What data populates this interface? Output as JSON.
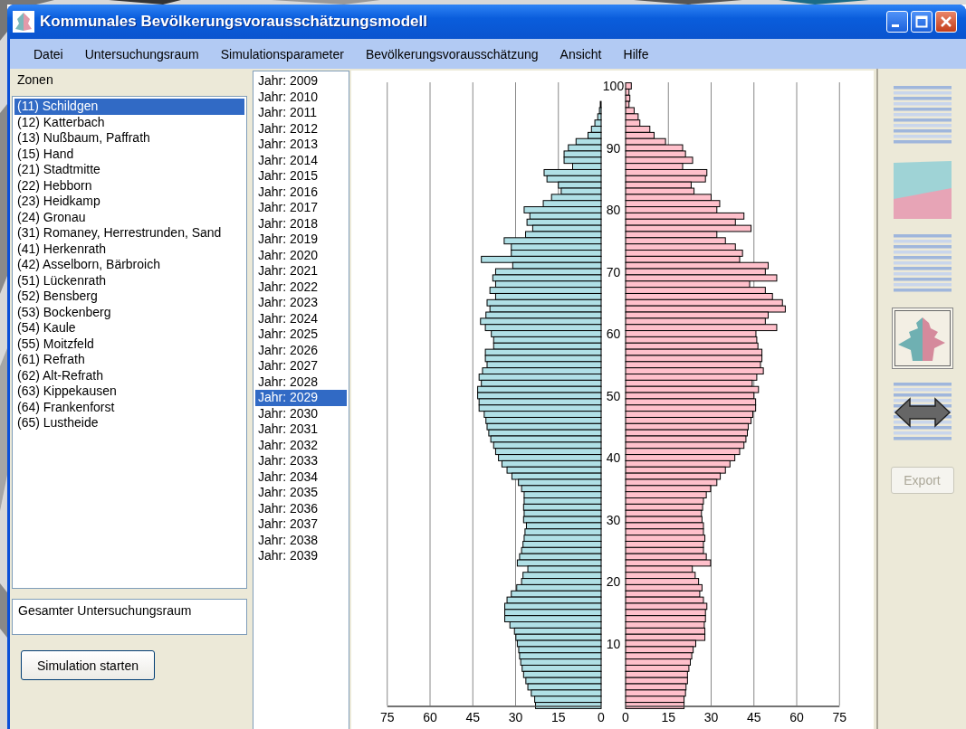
{
  "window": {
    "title": "Kommunales Bevölkerungsvorausschätzungsmodell"
  },
  "menu": [
    "Datei",
    "Untersuchungsraum",
    "Simulationsparameter",
    "Bevölkerungsvorausschätzung",
    "Ansicht",
    "Hilfe"
  ],
  "zones": {
    "label": "Zonen",
    "items": [
      {
        "label": "(11) Schildgen",
        "selected": true
      },
      {
        "label": "(12) Katterbach",
        "selected": false
      },
      {
        "label": "(13) Nußbaum, Paffrath",
        "selected": false
      },
      {
        "label": "(15) Hand",
        "selected": false
      },
      {
        "label": "(21) Stadtmitte",
        "selected": false
      },
      {
        "label": "(22) Hebborn",
        "selected": false
      },
      {
        "label": "(23) Heidkamp",
        "selected": false
      },
      {
        "label": "(24) Gronau",
        "selected": false
      },
      {
        "label": "(31) Romaney, Herrestrunden, Sand",
        "selected": false
      },
      {
        "label": "(41) Herkenrath",
        "selected": false
      },
      {
        "label": "(42) Asselborn, Bärbroich",
        "selected": false
      },
      {
        "label": "(51) Lückenrath",
        "selected": false
      },
      {
        "label": "(52) Bensberg",
        "selected": false
      },
      {
        "label": "(53) Bockenberg",
        "selected": false
      },
      {
        "label": "(54) Kaule",
        "selected": false
      },
      {
        "label": "(55) Moitzfeld",
        "selected": false
      },
      {
        "label": "(61) Refrath",
        "selected": false
      },
      {
        "label": "(62) Alt-Refrath",
        "selected": false
      },
      {
        "label": "(63) Kippekausen",
        "selected": false
      },
      {
        "label": "(64) Frankenforst",
        "selected": false
      },
      {
        "label": "(65) Lustheide",
        "selected": false
      }
    ]
  },
  "region_field": {
    "value": "Gesamter Untersuchungsraum"
  },
  "start_button": "Simulation starten",
  "years": [
    {
      "label": "Jahr: 2009",
      "selected": false
    },
    {
      "label": "Jahr: 2010",
      "selected": false
    },
    {
      "label": "Jahr: 2011",
      "selected": false
    },
    {
      "label": "Jahr: 2012",
      "selected": false
    },
    {
      "label": "Jahr: 2013",
      "selected": false
    },
    {
      "label": "Jahr: 2014",
      "selected": false
    },
    {
      "label": "Jahr: 2015",
      "selected": false
    },
    {
      "label": "Jahr: 2016",
      "selected": false
    },
    {
      "label": "Jahr: 2017",
      "selected": false
    },
    {
      "label": "Jahr: 2018",
      "selected": false
    },
    {
      "label": "Jahr: 2019",
      "selected": false
    },
    {
      "label": "Jahr: 2020",
      "selected": false
    },
    {
      "label": "Jahr: 2021",
      "selected": false
    },
    {
      "label": "Jahr: 2022",
      "selected": false
    },
    {
      "label": "Jahr: 2023",
      "selected": false
    },
    {
      "label": "Jahr: 2024",
      "selected": false
    },
    {
      "label": "Jahr: 2025",
      "selected": false
    },
    {
      "label": "Jahr: 2026",
      "selected": false
    },
    {
      "label": "Jahr: 2027",
      "selected": false
    },
    {
      "label": "Jahr: 2028",
      "selected": false
    },
    {
      "label": "Jahr: 2029",
      "selected": true
    },
    {
      "label": "Jahr: 2030",
      "selected": false
    },
    {
      "label": "Jahr: 2031",
      "selected": false
    },
    {
      "label": "Jahr: 2032",
      "selected": false
    },
    {
      "label": "Jahr: 2033",
      "selected": false
    },
    {
      "label": "Jahr: 2034",
      "selected": false
    },
    {
      "label": "Jahr: 2035",
      "selected": false
    },
    {
      "label": "Jahr: 2036",
      "selected": false
    },
    {
      "label": "Jahr: 2037",
      "selected": false
    },
    {
      "label": "Jahr: 2038",
      "selected": false
    },
    {
      "label": "Jahr: 2039",
      "selected": false
    }
  ],
  "pyramid": {
    "left": {
      "chart_data": {
        "type": "bar",
        "orientation": "horizontal",
        "categories": [
          null,
          null,
          null,
          null,
          null,
          null,
          null,
          null,
          null,
          null,
          null,
          null,
          null,
          null,
          null,
          null,
          null,
          null,
          null,
          null,
          null,
          null,
          null,
          null,
          null,
          null,
          null,
          null,
          null,
          null,
          null,
          null,
          null,
          null,
          null,
          null,
          null,
          null,
          null,
          null,
          null,
          null,
          null,
          null,
          null,
          null,
          null,
          null,
          null,
          null,
          null,
          null,
          null,
          null,
          null,
          null,
          null,
          null,
          null,
          null,
          null,
          null,
          null,
          null,
          null,
          null,
          null,
          null,
          null,
          null,
          null,
          null,
          null,
          null,
          null,
          null,
          null,
          null,
          null,
          null,
          null,
          null,
          null,
          null,
          null,
          null,
          null,
          null,
          null,
          null,
          null,
          null,
          null,
          null,
          null,
          null,
          null,
          null,
          null,
          null,
          null
        ],
        "xticks": [
          75,
          60,
          45,
          30,
          15,
          0
        ],
        "xlim": [
          75,
          0
        ],
        "grid": true,
        "series": [
          {
            "color": "#b0e0e6",
            "values": [
              0,
              0,
              0,
              0.3,
              0.6,
              1.2,
              2.2,
              3.4,
              4.6,
              8.8,
              11.5,
              13,
              13,
              10,
              20,
              19,
              15,
              14,
              17.4,
              20.3,
              27,
              25,
              26,
              24,
              26.5,
              34,
              31.5,
              31.5,
              42,
              31,
              37,
              38,
              37,
              39,
              37,
              40,
              39,
              40.4,
              42.3,
              40.6,
              38.5,
              37.7,
              37.7,
              40.6,
              40.6,
              40,
              41.6,
              42.8,
              42,
              43.3,
              43.3,
              42.8,
              42.8,
              41,
              40.4,
              40,
              39.4,
              38.7,
              37.7,
              37,
              36,
              34.8,
              33,
              31.3,
              29,
              27.9,
              27,
              27,
              27.2,
              27,
              27.2,
              26.2,
              26.7,
              27,
              27.4,
              27.9,
              28.6,
              29.4,
              25.7,
              27.4,
              27.9,
              29.6,
              31.5,
              33,
              33.8,
              33.8,
              33.8,
              32,
              30.4,
              29.9,
              29.4,
              28.9,
              28.6,
              28.2,
              27.7,
              27.2,
              26.4,
              25.7,
              24.5,
              23.3,
              23
            ]
          }
        ]
      }
    },
    "right": {
      "chart_data": {
        "type": "bar",
        "orientation": "horizontal",
        "categories": [
          "100",
          null,
          null,
          null,
          null,
          null,
          null,
          null,
          null,
          null,
          "90",
          null,
          null,
          null,
          null,
          null,
          null,
          null,
          null,
          null,
          "80",
          null,
          null,
          null,
          null,
          null,
          null,
          null,
          null,
          null,
          "70",
          null,
          null,
          null,
          null,
          null,
          null,
          null,
          null,
          null,
          "60",
          null,
          null,
          null,
          null,
          null,
          null,
          null,
          null,
          null,
          "50",
          null,
          null,
          null,
          null,
          null,
          null,
          null,
          null,
          null,
          "40",
          null,
          null,
          null,
          null,
          null,
          null,
          null,
          null,
          null,
          "30",
          null,
          null,
          null,
          null,
          null,
          null,
          null,
          null,
          null,
          "20",
          null,
          null,
          null,
          null,
          null,
          null,
          null,
          null,
          null,
          "10",
          null,
          null,
          null,
          null,
          null,
          null,
          null,
          null,
          null,
          null
        ],
        "xticks": [
          0,
          15,
          30,
          45,
          60,
          75
        ],
        "xlim": [
          0,
          75
        ],
        "grid": true,
        "series": [
          {
            "color": "#ffc0cb",
            "values": [
              2,
              1.2,
              1.5,
              1.2,
              3,
              4.4,
              5,
              8.5,
              10,
              14,
              20,
              21,
              23.5,
              20,
              28.5,
              28,
              23,
              24,
              30,
              33,
              32,
              41.5,
              38.5,
              44,
              32,
              35,
              38.5,
              41,
              40,
              50,
              49,
              53,
              43.5,
              49,
              51.5,
              55,
              56,
              50,
              49,
              53,
              45.7,
              46,
              46.4,
              47.8,
              47.8,
              47.3,
              48.3,
              46,
              44.4,
              46.6,
              45,
              45.6,
              45.6,
              44.6,
              44,
              43,
              42.7,
              42.2,
              41.5,
              40,
              38.3,
              36.6,
              35,
              33.2,
              32,
              29.8,
              28.3,
              27.3,
              27,
              26.6,
              26.8,
              27.3,
              27.3,
              27.8,
              27.3,
              27.3,
              28.3,
              29.8,
              23.4,
              24.4,
              25.6,
              26.8,
              26,
              27.3,
              28.5,
              28,
              28,
              27.6,
              27.8,
              27.8,
              24.6,
              23.7,
              23.2,
              22.7,
              22.2,
              21.7,
              21.7,
              21.2,
              21,
              20.5,
              20.5
            ]
          }
        ]
      }
    }
  },
  "views": [
    {
      "kind": "table",
      "selected": false
    },
    {
      "kind": "area",
      "selected": false
    },
    {
      "kind": "table",
      "selected": false
    },
    {
      "kind": "pyramid",
      "selected": true
    },
    {
      "kind": "exchange",
      "selected": false
    }
  ],
  "export_button": {
    "label": "Export",
    "disabled": true
  }
}
